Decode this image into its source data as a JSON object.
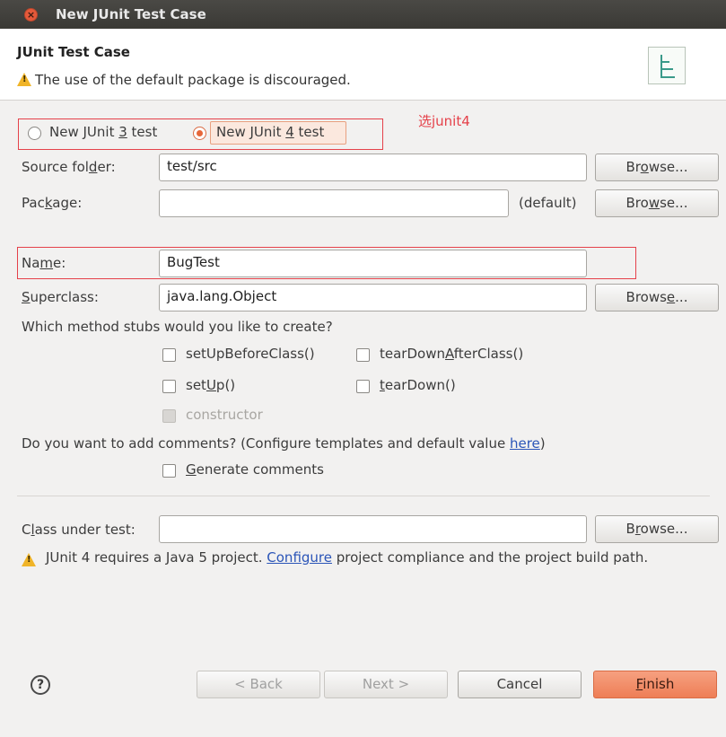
{
  "window": {
    "title": "New JUnit Test Case"
  },
  "header": {
    "heading": "JUnit Test Case",
    "warning": "The use of the default package is discouraged."
  },
  "annotation": "选junit4",
  "radios": {
    "junit3": "New JUnit 3 test",
    "junit4": "New JUnit 4 test",
    "selected": "junit4"
  },
  "source_folder": {
    "label": "Source folder:",
    "value": "test/src",
    "browse": "Browse..."
  },
  "package": {
    "label": "Package:",
    "value": "",
    "default_label": "(default)",
    "browse": "Browse..."
  },
  "name": {
    "label": "Name:",
    "value": "BugTest"
  },
  "superclass": {
    "label": "Superclass:",
    "value": "java.lang.Object",
    "browse": "Browse..."
  },
  "stubs": {
    "question": "Which method stubs would you like to create?",
    "setUpBeforeClass": "setUpBeforeClass()",
    "tearDownAfterClass": "tearDownAfterClass()",
    "setUp": "setUp()",
    "tearDown": "tearDown()",
    "constructor": "constructor"
  },
  "comments": {
    "question": "Do you want to add comments? (Configure templates and default value ",
    "link": "here",
    "suffix": ")",
    "generate": "Generate comments"
  },
  "class_under_test": {
    "label": "Class under test:",
    "value": "",
    "browse": "Browse..."
  },
  "requirement": {
    "text1": "JUnit 4 requires a Java 5 project. ",
    "link": "Configure",
    "text2": " project compliance and the project build path."
  },
  "footer": {
    "help": "?",
    "back": "< Back",
    "next": "Next >",
    "cancel": "Cancel",
    "finish": "Finish"
  },
  "colors": {
    "accent": "#ee7e56",
    "annotation": "#e5414a",
    "link": "#2b55b8"
  }
}
